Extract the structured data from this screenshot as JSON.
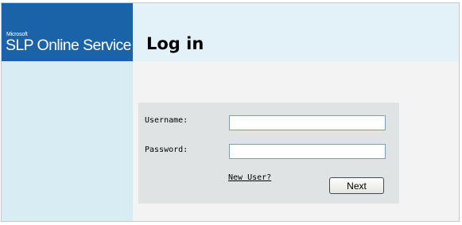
{
  "branding": {
    "company": "Microsoft",
    "product": "SLP Online Service"
  },
  "page": {
    "title": "Log in"
  },
  "login_form": {
    "username_label": "Username:",
    "username_value": "",
    "password_label": "Password:",
    "password_value": "",
    "new_user_link": "New User?",
    "next_button": "Next"
  },
  "colors": {
    "brand_blue": "#1a63a8",
    "header_band": "#e3f1f8",
    "sidebar": "#d8ecf4",
    "panel": "#dfe3e3"
  }
}
